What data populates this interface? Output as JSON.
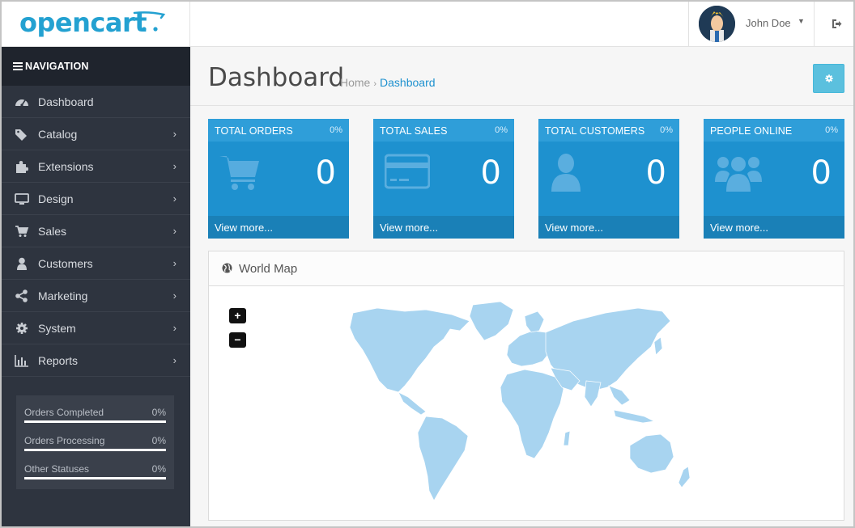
{
  "app": {
    "logo_text": "opencart",
    "user_name": "John Doe"
  },
  "sidebar": {
    "title": "NAVIGATION",
    "items": [
      {
        "label": "Dashboard",
        "icon": "dashboard-icon",
        "has_children": false
      },
      {
        "label": "Catalog",
        "icon": "tags-icon",
        "has_children": true
      },
      {
        "label": "Extensions",
        "icon": "puzzle-icon",
        "has_children": true
      },
      {
        "label": "Design",
        "icon": "monitor-icon",
        "has_children": true
      },
      {
        "label": "Sales",
        "icon": "cart-icon",
        "has_children": true
      },
      {
        "label": "Customers",
        "icon": "user-icon",
        "has_children": true
      },
      {
        "label": "Marketing",
        "icon": "share-icon",
        "has_children": true
      },
      {
        "label": "System",
        "icon": "gear-icon",
        "has_children": true
      },
      {
        "label": "Reports",
        "icon": "bar-chart-icon",
        "has_children": true
      }
    ],
    "status": [
      {
        "label": "Orders Completed",
        "value": "0%"
      },
      {
        "label": "Orders Processing",
        "value": "0%"
      },
      {
        "label": "Other Statuses",
        "value": "0%"
      }
    ]
  },
  "page": {
    "title": "Dashboard",
    "breadcrumb": [
      "Home",
      "Dashboard"
    ]
  },
  "tiles": [
    {
      "title": "TOTAL ORDERS",
      "percent": "0%",
      "value": "0",
      "link": "View more...",
      "icon": "cart-icon"
    },
    {
      "title": "TOTAL SALES",
      "percent": "0%",
      "value": "0",
      "link": "View more...",
      "icon": "credit-card-icon"
    },
    {
      "title": "TOTAL CUSTOMERS",
      "percent": "0%",
      "value": "0",
      "link": "View more...",
      "icon": "user-icon"
    },
    {
      "title": "PEOPLE ONLINE",
      "percent": "0%",
      "value": "0",
      "link": "View more...",
      "icon": "users-icon"
    }
  ],
  "map": {
    "title": "World Map",
    "zoom_in": "+",
    "zoom_out": "−"
  },
  "colors": {
    "brand": "#23a1d1",
    "tile": "#1e91cf",
    "sidebar": "#2e343f",
    "map_land": "#a8d4f0"
  }
}
